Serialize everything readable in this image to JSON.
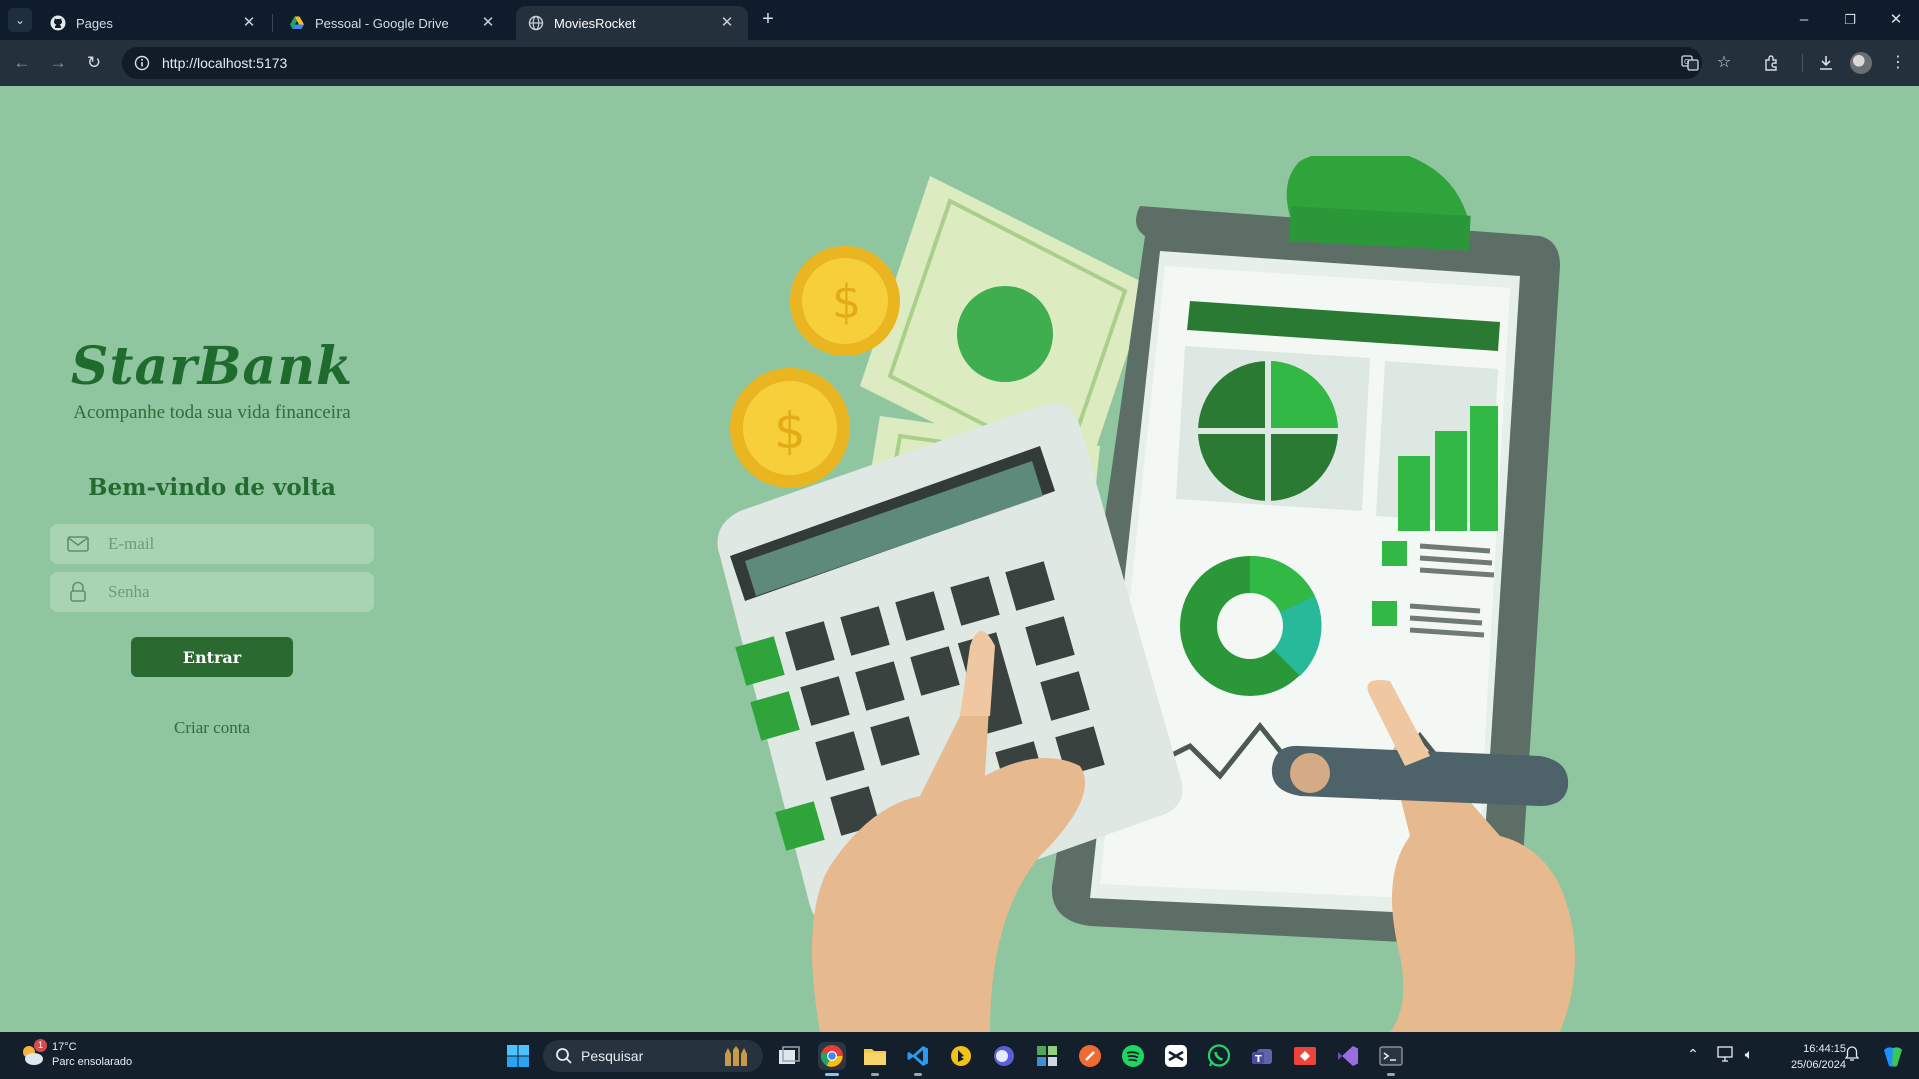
{
  "browser": {
    "tabs": [
      {
        "title": "Pages",
        "icon": "github-icon",
        "active": false
      },
      {
        "title": "Pessoal - Google Drive",
        "icon": "google-drive-icon",
        "active": false
      },
      {
        "title": "MoviesRocket",
        "icon": "globe-icon",
        "active": true
      }
    ],
    "url": "http://localhost:5173"
  },
  "login": {
    "logo": "StarBank",
    "tagline": "Acompanhe toda sua vida financeira",
    "welcome": "Bem-vindo de volta",
    "email_placeholder": "E-mail",
    "password_placeholder": "Senha",
    "submit_label": "Entrar",
    "create_account_label": "Criar conta"
  },
  "taskbar": {
    "weather_temp": "17°C",
    "weather_desc": "Parc ensolarado",
    "weather_badge": "1",
    "search_placeholder": "Pesquisar",
    "time": "16:44:15",
    "date": "25/06/2024"
  },
  "colors": {
    "page_bg": "#8fc6a0",
    "brand_green": "#1f6b2d",
    "button_green": "#2a6a31",
    "field_bg": "#a8d4b4"
  }
}
